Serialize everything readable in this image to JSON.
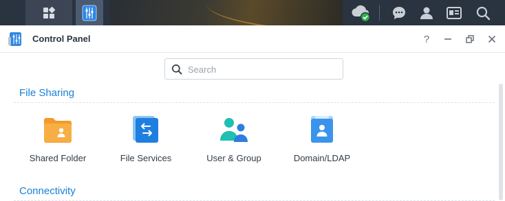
{
  "taskbar": {
    "main_menu_icon": "grid-icon",
    "active_app_icon": "control-panel-icon",
    "right_icons": [
      "cloud-sync-status-icon",
      "chat-icon",
      "user-icon",
      "widgets-icon",
      "search-icon"
    ]
  },
  "window": {
    "title": "Control Panel",
    "controls": {
      "help": "?",
      "minimize": "—",
      "restore": "restore-icon",
      "close": "✕"
    }
  },
  "search": {
    "placeholder": "Search",
    "value": ""
  },
  "sections": [
    {
      "title": "File Sharing",
      "items": [
        {
          "label": "Shared Folder",
          "icon": "shared-folder-icon"
        },
        {
          "label": "File Services",
          "icon": "file-services-icon"
        },
        {
          "label": "User & Group",
          "icon": "user-group-icon"
        },
        {
          "label": "Domain/LDAP",
          "icon": "domain-ldap-icon"
        }
      ]
    },
    {
      "title": "Connectivity",
      "items": []
    }
  ],
  "colors": {
    "taskbar_bg": "#2a3340",
    "accent_blue": "#1780d8",
    "folder_orange": "#f7a93b",
    "status_green": "#2bb24c"
  }
}
